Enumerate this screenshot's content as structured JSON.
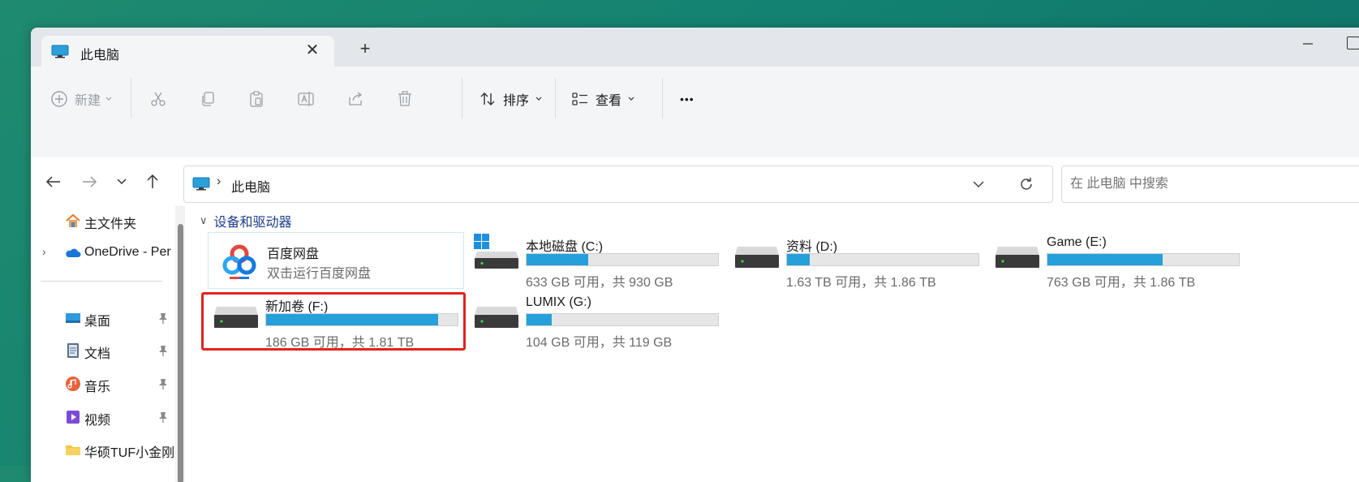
{
  "window": {
    "tab_title": "此电脑",
    "close_glyph": "✕",
    "new_tab_glyph": "+"
  },
  "toolbar": {
    "new_label": "新建",
    "sort_label": "排序",
    "view_label": "查看",
    "more_glyph": "•••"
  },
  "address": {
    "path": "此电脑",
    "separator": "›"
  },
  "search": {
    "placeholder": "在 此电脑 中搜索"
  },
  "sidebar": {
    "items": [
      {
        "label": "主文件夹",
        "icon": "home-icon"
      },
      {
        "label": "OneDrive - Per",
        "icon": "onedrive-icon",
        "expander": "›"
      },
      {
        "label": "桌面",
        "icon": "desktop-icon",
        "pinned": true
      },
      {
        "label": "文档",
        "icon": "documents-icon",
        "pinned": true
      },
      {
        "label": "音乐",
        "icon": "music-icon",
        "pinned": true
      },
      {
        "label": "视频",
        "icon": "video-icon",
        "pinned": true
      },
      {
        "label": "华硕TUF小金刚",
        "icon": "folder-icon"
      }
    ]
  },
  "content": {
    "group_title": "设备和驱动器",
    "group_chevron": "∨",
    "app": {
      "name": "百度网盘",
      "subtitle": "双击运行百度网盘"
    },
    "drives": [
      {
        "name": "本地磁盘 (C:)",
        "info": "633 GB 可用，共 930 GB",
        "used_fraction": 0.32,
        "system": true
      },
      {
        "name": "资料 (D:)",
        "info": "1.63 TB 可用，共 1.86 TB",
        "used_fraction": 0.12
      },
      {
        "name": "Game (E:)",
        "info": "763 GB 可用，共 1.86 TB",
        "used_fraction": 0.6
      },
      {
        "name": "新加卷 (F:)",
        "info": "186 GB 可用，共 1.81 TB",
        "used_fraction": 0.9,
        "highlighted": true
      },
      {
        "name": "LUMIX (G:)",
        "info": "104 GB 可用，共 119 GB",
        "used_fraction": 0.13
      }
    ]
  },
  "colors": {
    "accent_bar": "#26a0da",
    "highlight_border": "#e3241d",
    "group_title": "#1d3d8c"
  }
}
